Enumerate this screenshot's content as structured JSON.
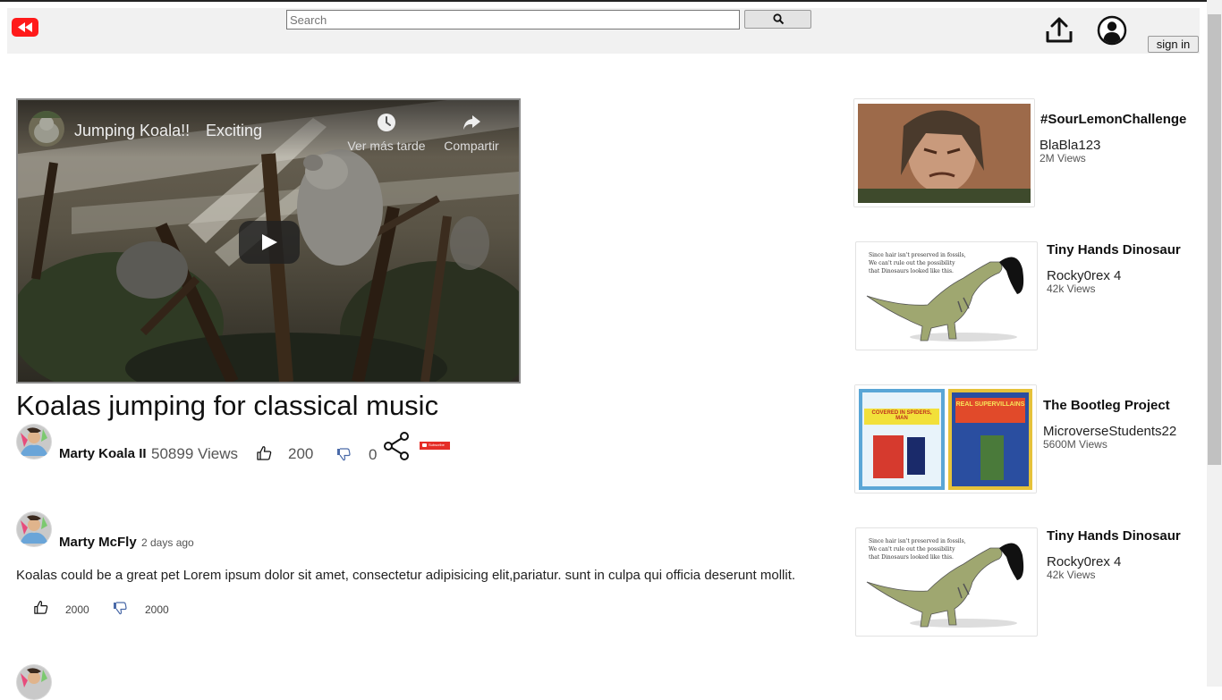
{
  "header": {
    "logo_icon": "rewind-icon",
    "brand_color": "#ff1a1a",
    "search": {
      "placeholder": "Search",
      "value": ""
    },
    "search_icon": "magnifier-icon",
    "upload_icon": "upload-icon",
    "account_icon": "account-circle-icon",
    "signin_label": "sign in"
  },
  "player": {
    "title": "Jumping Koala!!",
    "title_cont": "Exciting",
    "watch_later_label": "Ver más tarde",
    "share_label": "Compartir",
    "play_icon": "play-icon"
  },
  "video": {
    "title": "Koalas jumping for classical music",
    "owner": "Marty Koala II",
    "views": "50899 Views",
    "likes": "200",
    "dislikes": "0",
    "subscribe_label": "Subscribe"
  },
  "comments": [
    {
      "author": "Marty McFly",
      "time": "2 days ago",
      "text": "Koalas could be a great pet Lorem ipsum dolor sit amet, consectetur adipisicing elit,pariatur. sunt in culpa qui officia deserunt mollit.",
      "likes": "2000",
      "dislikes": "2000"
    }
  ],
  "recommendations": [
    {
      "title": "#SourLemonChallenge",
      "channel": "BlaBla123",
      "views": "2M Views"
    },
    {
      "title": "Tiny Hands Dinosaur",
      "channel": "Rocky0rex 4",
      "views": "42k Views",
      "caption": "Since hair isn't preserved in fossils, We can't rule out the possibility that Dinosaurs looked like this."
    },
    {
      "title": "The Bootleg Project",
      "channel": "MicroverseStudents22",
      "views": "5600M Views",
      "toy_left": "COVERED IN SPIDERS, MAN",
      "toy_right": "REAL SUPERVILLAINS"
    },
    {
      "title": "Tiny Hands Dinosaur",
      "channel": "Rocky0rex 4",
      "views": "42k Views",
      "caption": "Since hair isn't preserved in fossils, We can't rule out the possibility that Dinosaurs looked like this."
    }
  ]
}
